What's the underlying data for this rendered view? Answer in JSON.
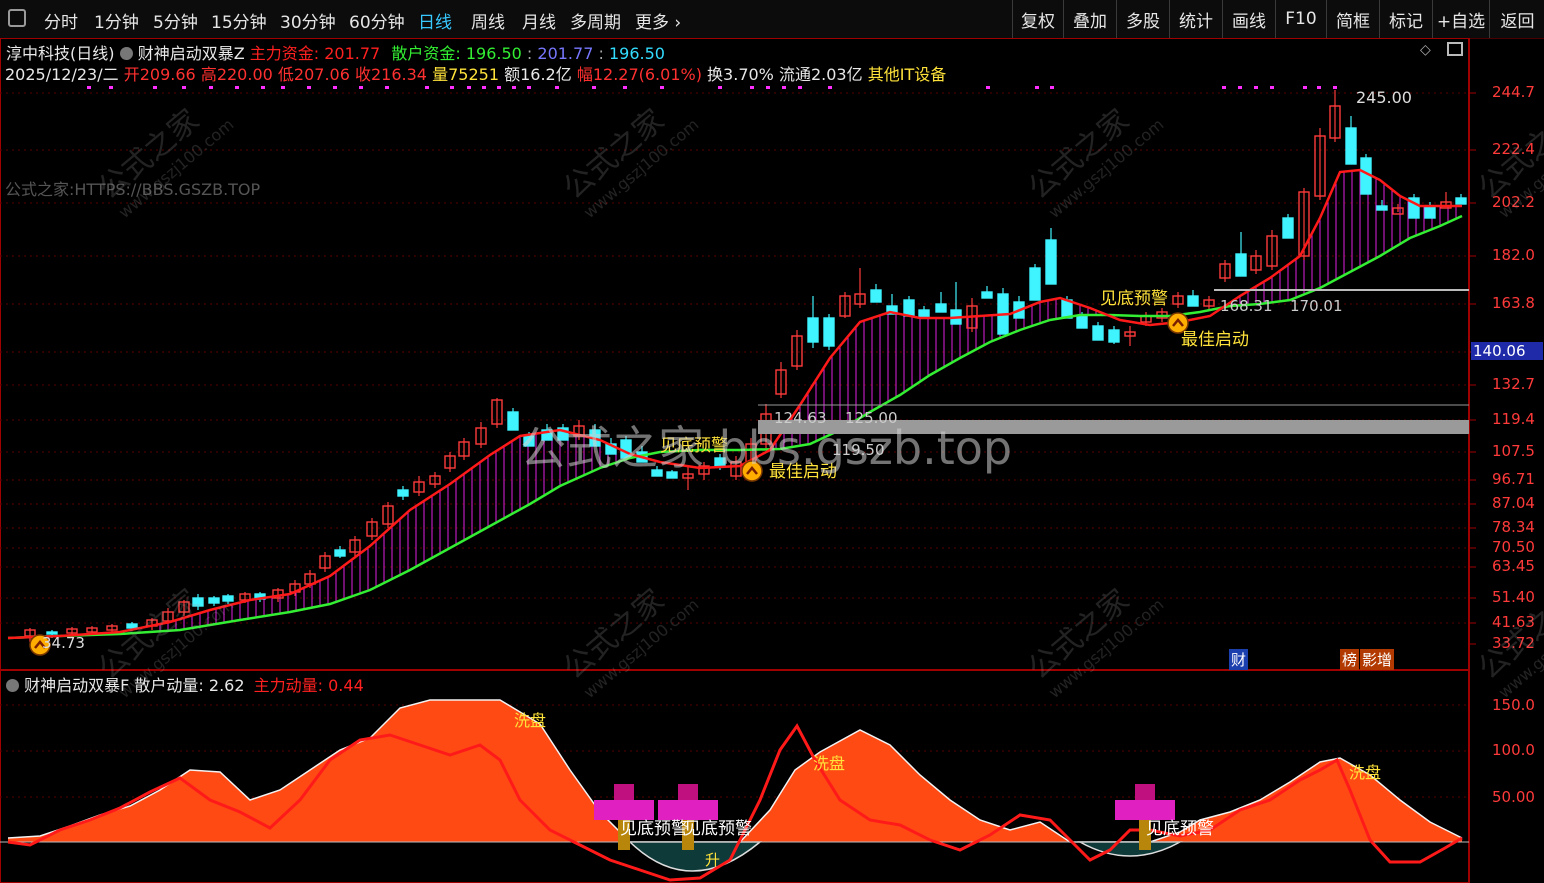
{
  "toolbar": {
    "periods": [
      "分时",
      "1分钟",
      "5分钟",
      "15分钟",
      "30分钟",
      "60分钟",
      "日线",
      "周线",
      "月线",
      "多周期",
      "更多"
    ],
    "more_arrow": "›",
    "active_index": 6,
    "right_buttons": [
      "复权",
      "叠加",
      "多股",
      "统计",
      "画线",
      "F10",
      "简框",
      "标记",
      "+自选",
      "返回"
    ]
  },
  "header": {
    "stock_title": "淳中科技(日线)",
    "indicator_name": "财神启动双暴Z",
    "main_fund_label": "主力资金:",
    "main_fund_value": "201.77",
    "retail_fund_label": "散户资金:",
    "retail_fund_value": "196.50",
    "ref_value1": "201.77",
    "ref_value2": "196.50"
  },
  "info": {
    "date": "2025/12/23/二",
    "open": "开209.66",
    "high": "高220.00",
    "low": "低207.06",
    "close": "收216.34",
    "volume": "量75251",
    "amount": "额16.2亿",
    "change": "幅12.27(6.01%)",
    "turnover": "换3.70%",
    "float": "流通2.03亿",
    "sector": "其他IT设备"
  },
  "watermark": {
    "left_text": "公式之家:HTTPS://BBS.GSZB.TOP",
    "center_text": "公式之家 bbs.gszb.top",
    "tile_cn": "公式之家",
    "tile_url": "www.gszj100.com"
  },
  "price_axis": {
    "labels": [
      "244.7",
      "222.4",
      "202.2",
      "182.0",
      "163.8",
      "140.06",
      "132.7",
      "119.4",
      "107.5",
      "96.71",
      "87.04",
      "78.34",
      "70.50",
      "63.45",
      "51.40",
      "41.63",
      "33.72"
    ],
    "current_price": "140.06"
  },
  "annotations": {
    "high_label": "245.00",
    "low_label": "34.73",
    "bottom_warn": "见底预警",
    "best_start": "最佳启动",
    "level_a1": "168.31",
    "level_a2": "170.01",
    "level_b1": "124.63",
    "level_b2": "125.00",
    "level_b3": "119.50",
    "tag_cai": "财",
    "tag_bang": "榜",
    "tag_ying": "影增"
  },
  "sub_header": {
    "indicator_name": "财神启动双暴F",
    "retail_label": "散户动量:",
    "retail_value": "2.62",
    "main_label": "主力动量:",
    "main_value": "0.44"
  },
  "sub_axis": {
    "labels": [
      "150.0",
      "100.0",
      "50.00"
    ]
  },
  "sub_annotations": {
    "wash": "洗盘",
    "bottom_warn": "见底预警",
    "rise": "升",
    "bottom_warn_short": "见底预警"
  },
  "colors": {
    "up": "#ff3b3b",
    "down": "#3ff3ff",
    "ma_red": "#ff1a1a",
    "ma_green": "#33ee33",
    "fill_magenta": "#ff30ff",
    "area_orange": "#ff4a14",
    "frame": "#a00000"
  }
}
